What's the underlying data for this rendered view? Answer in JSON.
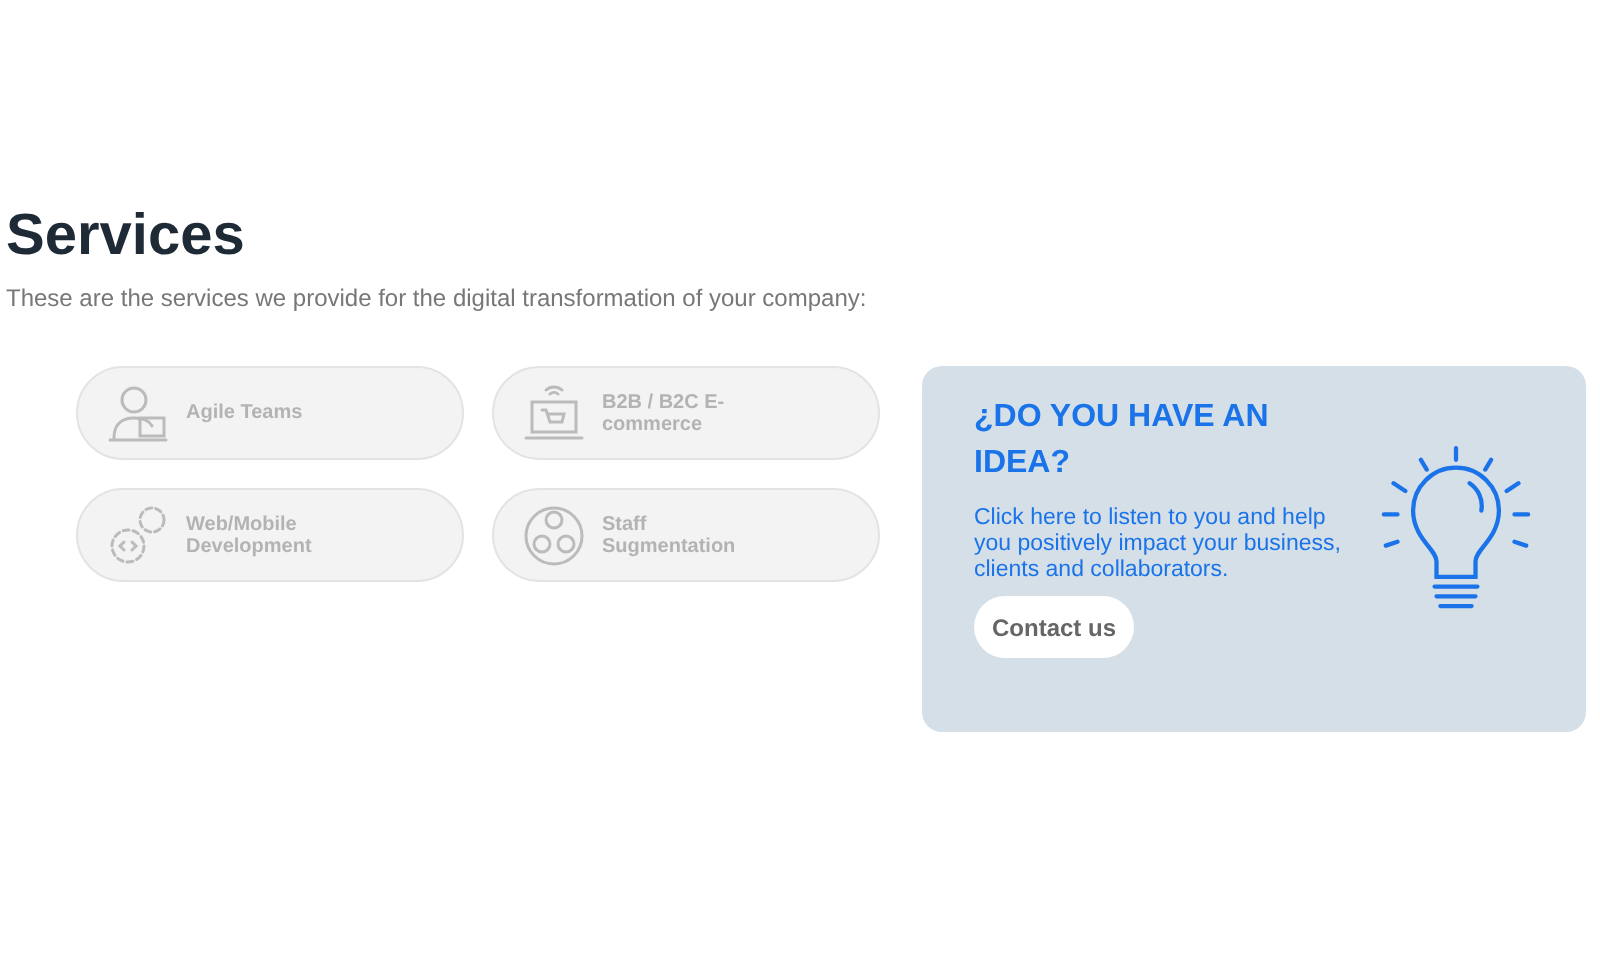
{
  "heading": "Services",
  "intro": "These are the services we provide for the digital transformation of your company:",
  "services": [
    {
      "kind": "team",
      "label": "Agile Teams"
    },
    {
      "kind": "ecommerce",
      "label": "B2B / B2C E-commerce"
    },
    {
      "kind": "code",
      "label": "Web/Mobile Development"
    },
    {
      "kind": "people",
      "label": "Staff Sugmentation"
    }
  ],
  "idea_card": {
    "title": "¿DO YOU HAVE AN IDEA?",
    "text": "Click here to listen to you and help you positively impact your business, clients and collaborators.",
    "button": "Contact us"
  }
}
